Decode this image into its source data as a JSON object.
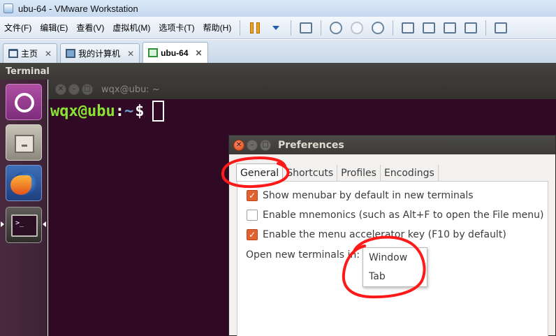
{
  "vmware": {
    "title": "ubu-64 - VMware Workstation",
    "menus": [
      "文件(F)",
      "编辑(E)",
      "查看(V)",
      "虚拟机(M)",
      "选项卡(T)",
      "帮助(H)"
    ],
    "tabs": [
      {
        "label": "主页",
        "close": "✕"
      },
      {
        "label": "我的计算机",
        "close": "✕"
      },
      {
        "label": "ubu-64",
        "close": "✕"
      }
    ]
  },
  "ubuntu": {
    "topbar_title": "Terminal"
  },
  "terminal": {
    "window_title": "wqx@ubu: ~",
    "prompt_user": "wqx@ubu",
    "prompt_colon": ":",
    "prompt_path": "~",
    "prompt_dollar": "$",
    "launcher_prompt": ">_"
  },
  "preferences": {
    "title": "Preferences",
    "tabs": [
      "General",
      "Shortcuts",
      "Profiles",
      "Encodings"
    ],
    "options": [
      {
        "label": "Show menubar by default in new terminals",
        "checked": true
      },
      {
        "label": "Enable mnemonics (such as Alt+F to open the File menu)",
        "checked": false
      },
      {
        "label": "Enable the menu accelerator key (F10 by default)",
        "checked": true
      }
    ],
    "open_new_label": "Open new terminals in:",
    "dropdown_options": [
      "Window",
      "Tab"
    ]
  },
  "window_buttons": {
    "close": "✕",
    "minimize": "–",
    "maximize": "□"
  },
  "checkmark": "✓",
  "colors": {
    "terminal_bg": "#300a24",
    "prompt_user": "#8ae234",
    "prompt_path": "#729fcf",
    "checkbox_checked": "#e0612f",
    "annotation_red": "#ff1a1a"
  }
}
